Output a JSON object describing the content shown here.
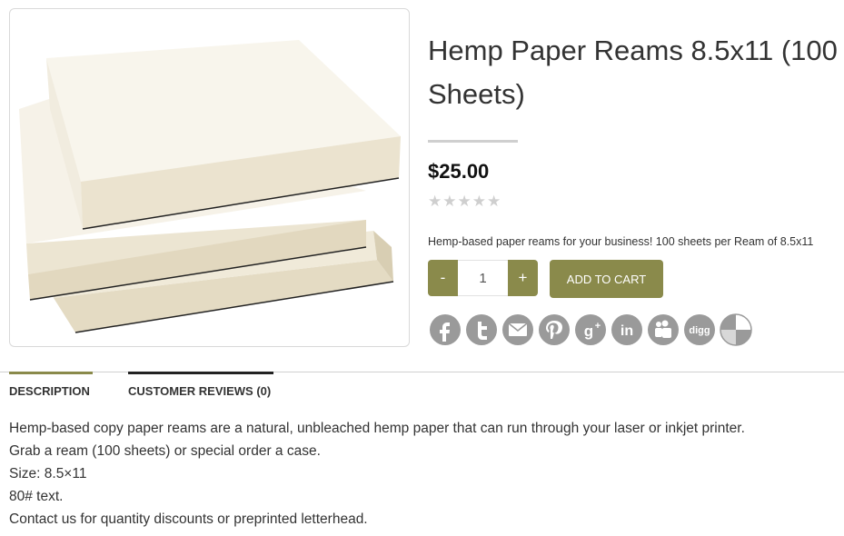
{
  "product": {
    "title": "Hemp Paper Reams 8.5x11 (100 Sheets)",
    "price": "$25.00",
    "rating_stars": "★★★★★",
    "rating_value": 0,
    "short_description": "Hemp-based paper reams for your business! 100 sheets per Ream of 8.5x11"
  },
  "cart": {
    "minus_label": "-",
    "plus_label": "+",
    "quantity": "1",
    "add_to_cart_label": "ADD TO CART"
  },
  "social": [
    {
      "name": "facebook-icon",
      "glyph": "f"
    },
    {
      "name": "twitter-icon",
      "glyph": "t"
    },
    {
      "name": "email-icon",
      "glyph": "✉"
    },
    {
      "name": "pinterest-icon",
      "glyph": "p"
    },
    {
      "name": "google-plus-icon",
      "glyph": "g+"
    },
    {
      "name": "linkedin-icon",
      "glyph": "in"
    },
    {
      "name": "myspace-icon",
      "glyph": "m"
    },
    {
      "name": "digg-icon",
      "glyph": "digg"
    },
    {
      "name": "delicious-icon",
      "glyph": ""
    }
  ],
  "tabs": {
    "description": "DESCRIPTION",
    "reviews": "CUSTOMER REVIEWS (0)"
  },
  "description_lines": [
    "Hemp-based copy paper reams are a natural, unbleached hemp paper that can run through your laser or inkjet printer.",
    "Grab a ream (100 sheets) or special order a case.",
    "Size: 8.5×11",
    "80# text.",
    "Contact us for quantity discounts or preprinted letterhead."
  ],
  "colors": {
    "accent": "#8a8a4b",
    "icon_gray": "#9a9a9a"
  }
}
